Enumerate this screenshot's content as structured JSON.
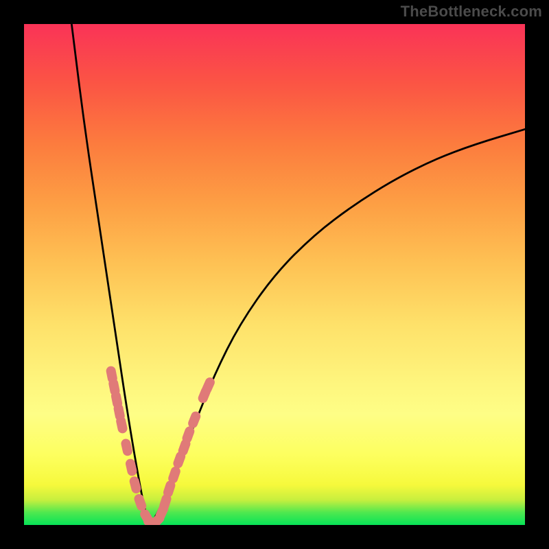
{
  "watermark": "TheBottleneck.com",
  "chart_data": {
    "type": "line",
    "title": "",
    "xlabel": "",
    "ylabel": "",
    "xlim": [
      0,
      1
    ],
    "ylim": [
      0,
      1
    ],
    "series": [
      {
        "name": "bottleneck-curve",
        "x": [
          0.095,
          0.12,
          0.15,
          0.18,
          0.21,
          0.24,
          0.252,
          0.27,
          0.3,
          0.34,
          0.38,
          0.43,
          0.5,
          0.58,
          0.66,
          0.74,
          0.82,
          0.9,
          1.0
        ],
        "y": [
          1.0,
          0.8,
          0.6,
          0.4,
          0.2,
          0.03,
          0.0,
          0.03,
          0.1,
          0.2,
          0.3,
          0.4,
          0.5,
          0.58,
          0.64,
          0.69,
          0.73,
          0.76,
          0.79
        ]
      }
    ],
    "marker_points": {
      "name": "sample-markers",
      "color": "#e07a78",
      "points": [
        {
          "x": 0.175,
          "y": 0.3
        },
        {
          "x": 0.18,
          "y": 0.275
        },
        {
          "x": 0.185,
          "y": 0.25
        },
        {
          "x": 0.19,
          "y": 0.225
        },
        {
          "x": 0.195,
          "y": 0.2
        },
        {
          "x": 0.205,
          "y": 0.155
        },
        {
          "x": 0.214,
          "y": 0.115
        },
        {
          "x": 0.222,
          "y": 0.08
        },
        {
          "x": 0.232,
          "y": 0.045
        },
        {
          "x": 0.245,
          "y": 0.015
        },
        {
          "x": 0.255,
          "y": 0.005
        },
        {
          "x": 0.265,
          "y": 0.008
        },
        {
          "x": 0.275,
          "y": 0.025
        },
        {
          "x": 0.282,
          "y": 0.045
        },
        {
          "x": 0.29,
          "y": 0.072
        },
        {
          "x": 0.3,
          "y": 0.1
        },
        {
          "x": 0.31,
          "y": 0.13
        },
        {
          "x": 0.32,
          "y": 0.155
        },
        {
          "x": 0.328,
          "y": 0.18
        },
        {
          "x": 0.34,
          "y": 0.21
        },
        {
          "x": 0.36,
          "y": 0.26
        },
        {
          "x": 0.368,
          "y": 0.278
        }
      ]
    }
  }
}
